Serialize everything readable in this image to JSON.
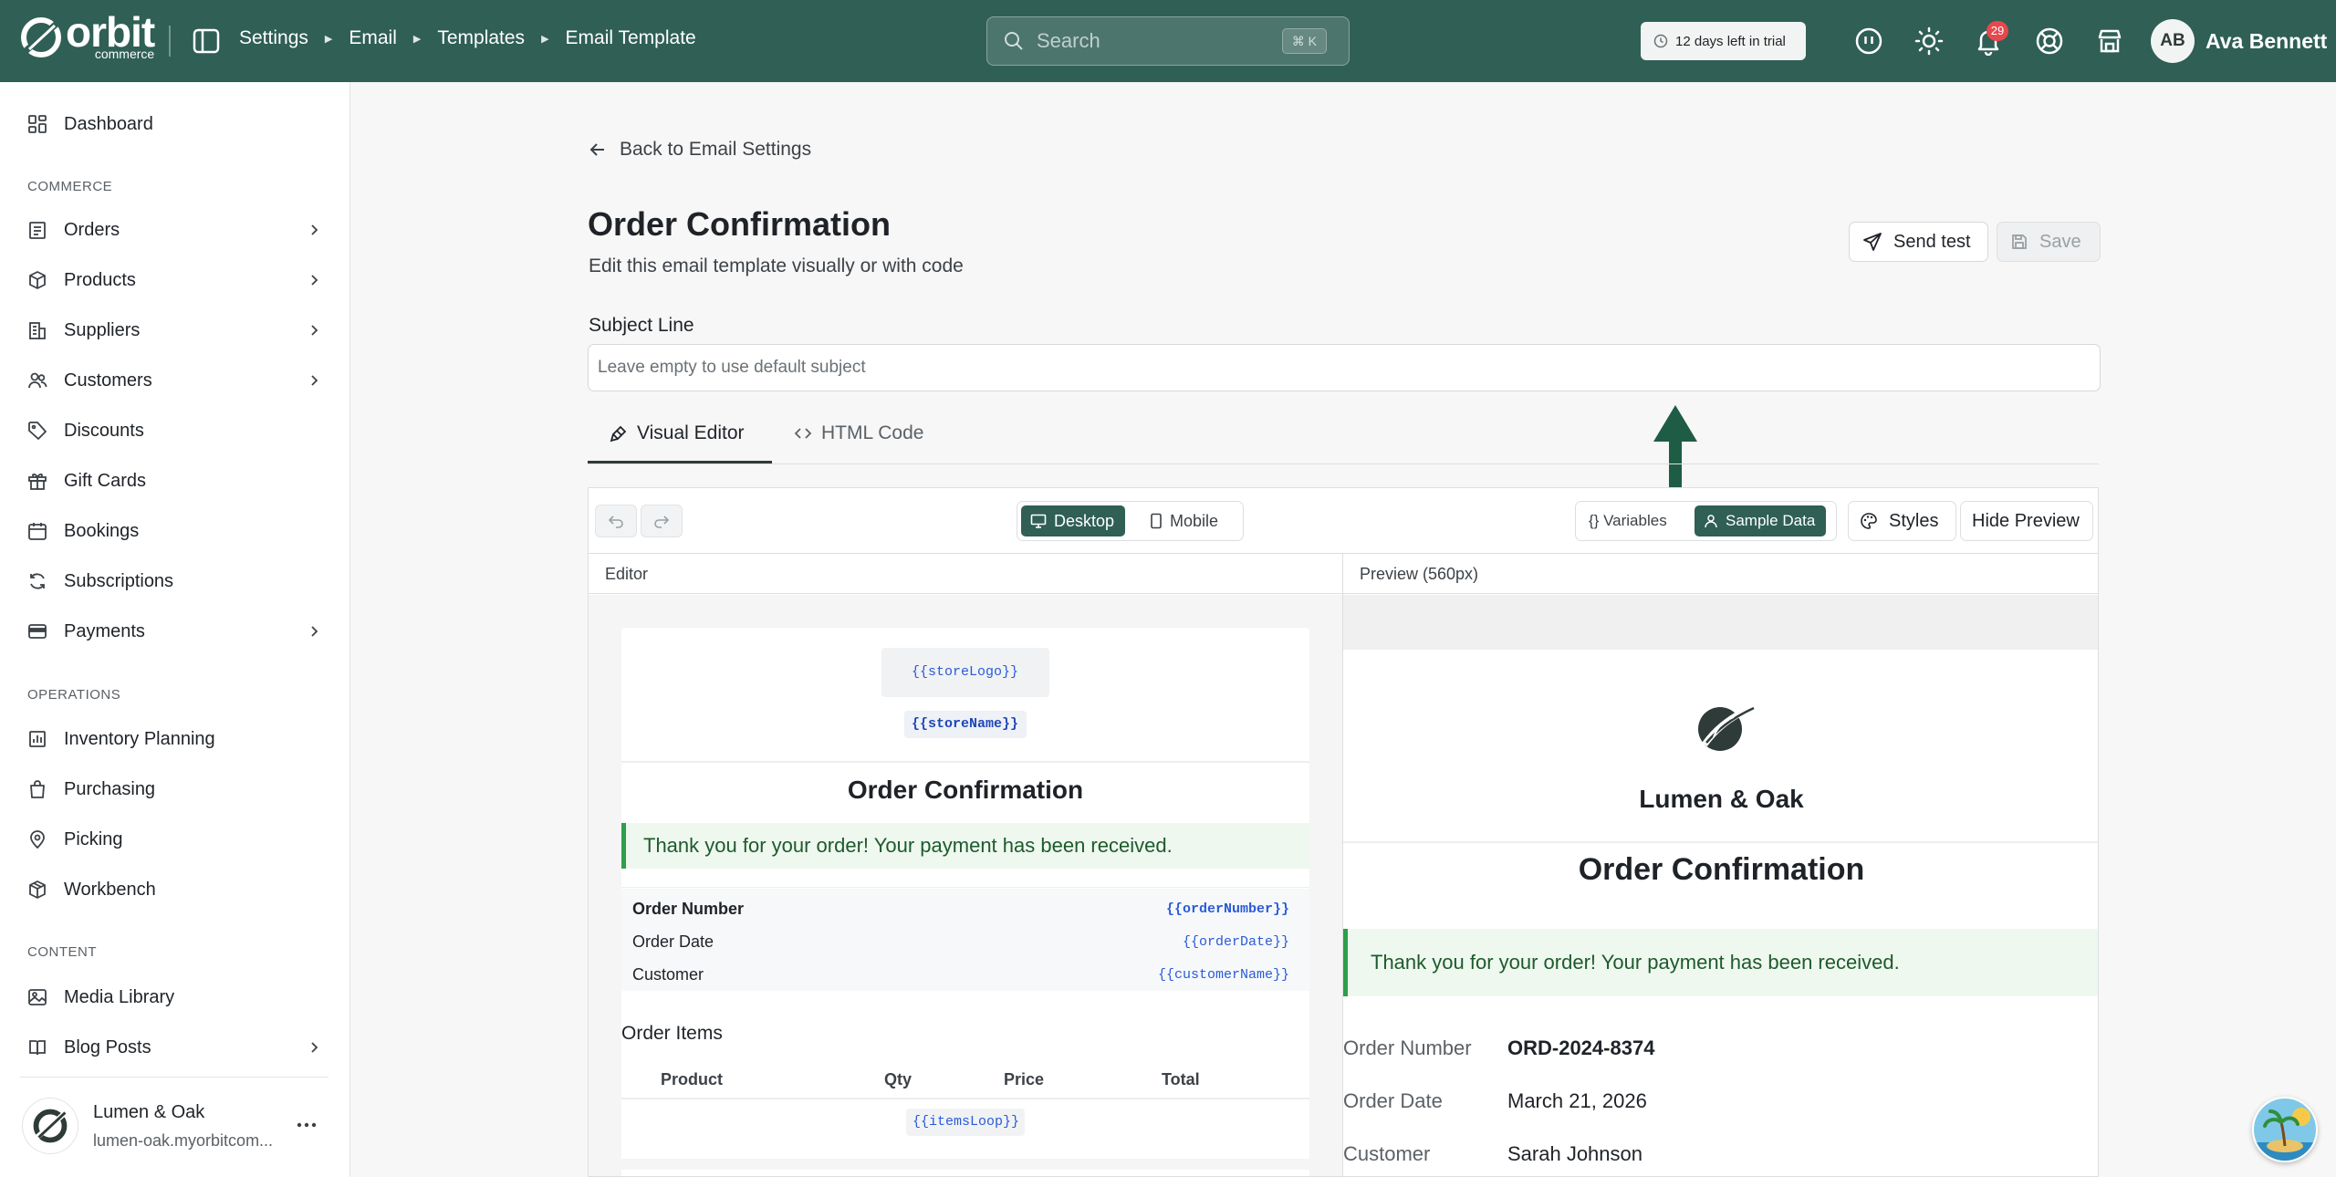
{
  "app": {
    "logo_text": "orbit",
    "logo_sub": "commerce"
  },
  "breadcrumb": [
    "Settings",
    "Email",
    "Templates",
    "Email Template"
  ],
  "search": {
    "placeholder": "Search",
    "shortcut": "⌘ K"
  },
  "trial": {
    "label": "12 days left in trial"
  },
  "notifications": {
    "count": "29"
  },
  "user": {
    "initials": "AB",
    "name": "Ava Bennett"
  },
  "sidebar": {
    "dashboard": "Dashboard",
    "sections": {
      "commerce": "COMMERCE",
      "operations": "OPERATIONS",
      "content": "CONTENT"
    },
    "commerce_items": [
      {
        "label": "Orders",
        "icon": "clipboard-list-icon",
        "has_children": true
      },
      {
        "label": "Products",
        "icon": "box-icon",
        "has_children": true
      },
      {
        "label": "Suppliers",
        "icon": "building-icon",
        "has_children": true
      },
      {
        "label": "Customers",
        "icon": "users-icon",
        "has_children": true
      },
      {
        "label": "Discounts",
        "icon": "tag-icon",
        "has_children": false
      },
      {
        "label": "Gift Cards",
        "icon": "gift-icon",
        "has_children": false
      },
      {
        "label": "Bookings",
        "icon": "calendar-icon",
        "has_children": false
      },
      {
        "label": "Subscriptions",
        "icon": "refresh-icon",
        "has_children": false
      },
      {
        "label": "Payments",
        "icon": "credit-card-icon",
        "has_children": true
      }
    ],
    "operations_items": [
      {
        "label": "Inventory Planning",
        "icon": "chart-icon"
      },
      {
        "label": "Purchasing",
        "icon": "bag-icon"
      },
      {
        "label": "Picking",
        "icon": "map-pin-icon"
      },
      {
        "label": "Workbench",
        "icon": "package-icon"
      }
    ],
    "content_items": [
      {
        "label": "Media Library",
        "icon": "image-icon",
        "has_children": false
      },
      {
        "label": "Blog Posts",
        "icon": "book-icon",
        "has_children": true
      }
    ],
    "store": {
      "name": "Lumen & Oak",
      "url": "lumen-oak.myorbitcom..."
    }
  },
  "page": {
    "back_label": "Back to Email Settings",
    "title": "Order Confirmation",
    "subtitle": "Edit this email template visually or with code",
    "send_test": "Send test",
    "save": "Save",
    "subject_label": "Subject Line",
    "subject_placeholder": "Leave empty to use default subject",
    "subject_value": "",
    "tabs": [
      "Visual Editor",
      "HTML Code"
    ],
    "active_tab": "Visual Editor"
  },
  "toolbar": {
    "desktop": "Desktop",
    "mobile": "Mobile",
    "variables": "{} Variables",
    "sample_data": "Sample Data",
    "styles": "Styles",
    "hide_preview": "Hide Preview"
  },
  "editor": {
    "header": "Editor",
    "store_logo_var": "{{storeLogo}}",
    "store_name_var": "{{storeName}}",
    "title": "Order Confirmation",
    "banner": "Thank you for your order! Your payment has been received.",
    "info": [
      {
        "label": "Order Number",
        "var": "{{orderNumber}}"
      },
      {
        "label": "Order Date",
        "var": "{{orderDate}}"
      },
      {
        "label": "Customer",
        "var": "{{customerName}}"
      }
    ],
    "items_title": "Order Items",
    "columns": [
      "Product",
      "Qty",
      "Price",
      "Total"
    ],
    "items_loop_var": "{{itemsLoop}}"
  },
  "preview": {
    "header": "Preview (560px)",
    "store_name": "Lumen & Oak",
    "title": "Order Confirmation",
    "banner": "Thank you for your order! Your payment has been received.",
    "info": [
      {
        "label": "Order Number",
        "value": "ORD-2024-8374"
      },
      {
        "label": "Order Date",
        "value": "March 21, 2026"
      },
      {
        "label": "Customer",
        "value": "Sarah Johnson"
      }
    ]
  },
  "colors": {
    "topbar": "#2f5f55",
    "accent": "#2f5f55",
    "success": "#2e9e4a",
    "variable": "#2a5bd7",
    "badge": "#e5484d"
  }
}
